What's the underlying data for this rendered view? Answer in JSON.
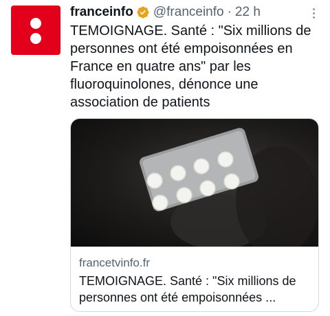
{
  "account": {
    "display_name": "franceinfo",
    "handle": "@franceinfo",
    "separator": "·",
    "time": "22 h",
    "verified_icon": "verified-badge-icon",
    "avatar_color": "#e2001a"
  },
  "tweet": {
    "text": "TEMOIGNAGE. Santé : \"Six millions de personnes ont été empoisonnées en France en quatre ans\" par les fluoroquinolones, dénonce une association de patients"
  },
  "card": {
    "domain": "francetvinfo.fr",
    "title": "TEMOIGNAGE. Santé : \"Six millions de personnes ont été empoisonnées ...",
    "image_icon": "pill-blister-photo"
  },
  "colors": {
    "text": "#0f1419",
    "secondary": "#536471",
    "border": "#cfd9de",
    "verified": "#e8a317"
  }
}
